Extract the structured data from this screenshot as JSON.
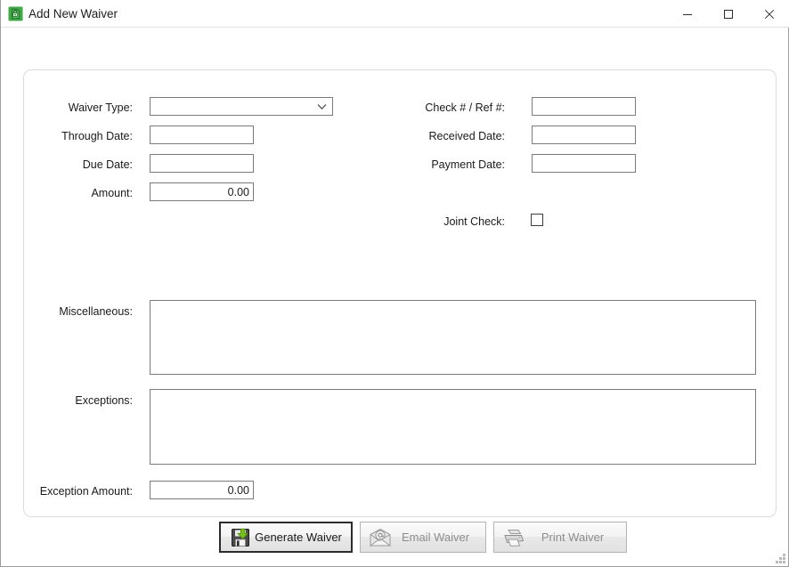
{
  "window": {
    "title": "Add New Waiver",
    "icon": "waiver-document-lock-icon",
    "minimize_label": "Minimize",
    "maximize_label": "Maximize",
    "close_label": "Close",
    "accent_green": "#4caf21",
    "border_color": "#9e9e9e"
  },
  "form": {
    "left": {
      "waiver_type": {
        "label": "Waiver Type:",
        "value": "",
        "placeholder": ""
      },
      "through_date": {
        "label": "Through Date:",
        "value": "",
        "placeholder": ""
      },
      "due_date": {
        "label": "Due Date:",
        "value": "",
        "placeholder": ""
      },
      "amount": {
        "label": "Amount:",
        "value": "0.00",
        "placeholder": ""
      }
    },
    "right": {
      "check_ref": {
        "label": "Check # / Ref #:",
        "value": "",
        "placeholder": ""
      },
      "received_date": {
        "label": "Received Date:",
        "value": "",
        "placeholder": ""
      },
      "payment_date": {
        "label": "Payment Date:",
        "value": "",
        "placeholder": ""
      },
      "joint_check": {
        "label": "Joint Check:",
        "checked": false
      }
    },
    "misc": {
      "label": "Miscellaneous:",
      "value": "",
      "placeholder": ""
    },
    "exceptions": {
      "label": "Exceptions:",
      "value": "",
      "placeholder": ""
    },
    "exception_amount": {
      "label": "Exception Amount:",
      "value": "0.00",
      "placeholder": ""
    }
  },
  "actions": [
    {
      "id": "generate-waiver",
      "label": "Generate Waiver",
      "icon": "save-floppy-icon",
      "enabled": true,
      "default": true
    },
    {
      "id": "email-waiver",
      "label": "Email Waiver",
      "icon": "email-envelope-icon",
      "enabled": false,
      "default": false
    },
    {
      "id": "print-waiver",
      "label": "Print Waiver",
      "icon": "printer-icon",
      "enabled": false,
      "default": false
    }
  ]
}
